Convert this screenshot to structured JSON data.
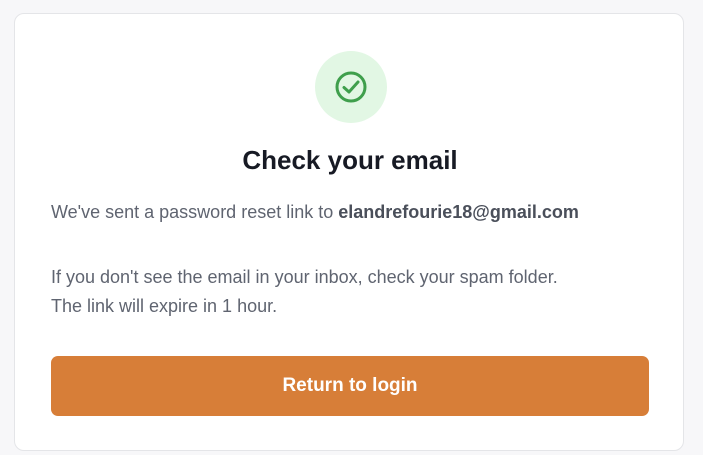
{
  "card": {
    "icon": "check-circle-icon",
    "icon_color": "#3f9f4c",
    "icon_bg": "#e2f7e4",
    "title": "Check your email",
    "sent_prefix": "We've sent a password reset link to ",
    "email": "elandrefourie18@gmail.com",
    "help_line_1": "If you don't see the email in your inbox, check your spam folder.",
    "help_line_2": "The link will expire in 1 hour.",
    "button_label": "Return to login",
    "button_color": "#d77e38"
  }
}
